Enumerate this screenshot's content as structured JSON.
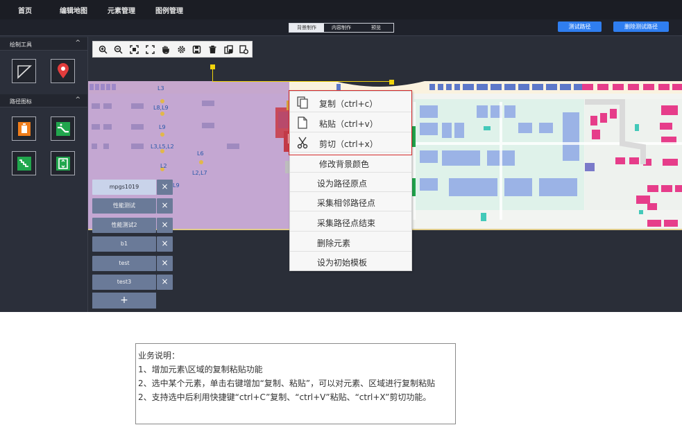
{
  "topnav": {
    "items": [
      "首页",
      "编辑地图",
      "元素管理",
      "图例管理"
    ]
  },
  "subbar": {
    "modes": [
      "背景制作",
      "内容制作",
      "预览"
    ],
    "active_mode": "背景制作",
    "test_path_button": "测试路径",
    "delete_test_path_button": "删除测试路径"
  },
  "sidebar": {
    "draw_tools_title": "绘制工具",
    "path_icons_title": "路径图标",
    "chevron": "^"
  },
  "elements": {
    "items": [
      "mpgs1019",
      "性能测试",
      "性能测试2",
      "b1",
      "test",
      "test3"
    ],
    "selected": "mpgs1019",
    "delete_symbol": "×",
    "add_symbol": "+"
  },
  "map_labels": [
    "L3",
    "L8,L9",
    "L9",
    "L3,L5,L2",
    "L6",
    "L2",
    "L2,L7",
    "L9"
  ],
  "context_menu": {
    "items": [
      "复制（ctrl+c）",
      "粘贴（ctrl+v）",
      "剪切（ctrl+x）",
      "修改背景颜色",
      "设为路径原点",
      "采集相邻路径点",
      "采集路径点结束",
      "删除元素",
      "设为初始模板"
    ]
  },
  "description": {
    "lines": [
      "业务说明：",
      "1、增加元素\\区域的复制粘贴功能",
      "2、选中某个元素，单击右键增加“复制、粘贴”，可以对元素、区域进行复制粘贴",
      "2、支持选中后利用快捷键“ctrl+C”复制、“ctrl+V”粘贴、“ctrl+X”剪切功能。"
    ]
  },
  "colors": {
    "accent_blue": "#2f7ef0",
    "highlight_red": "#d42a2a",
    "overlay_purple": "#b48ec7",
    "selection_yellow": "#f0d30c"
  }
}
